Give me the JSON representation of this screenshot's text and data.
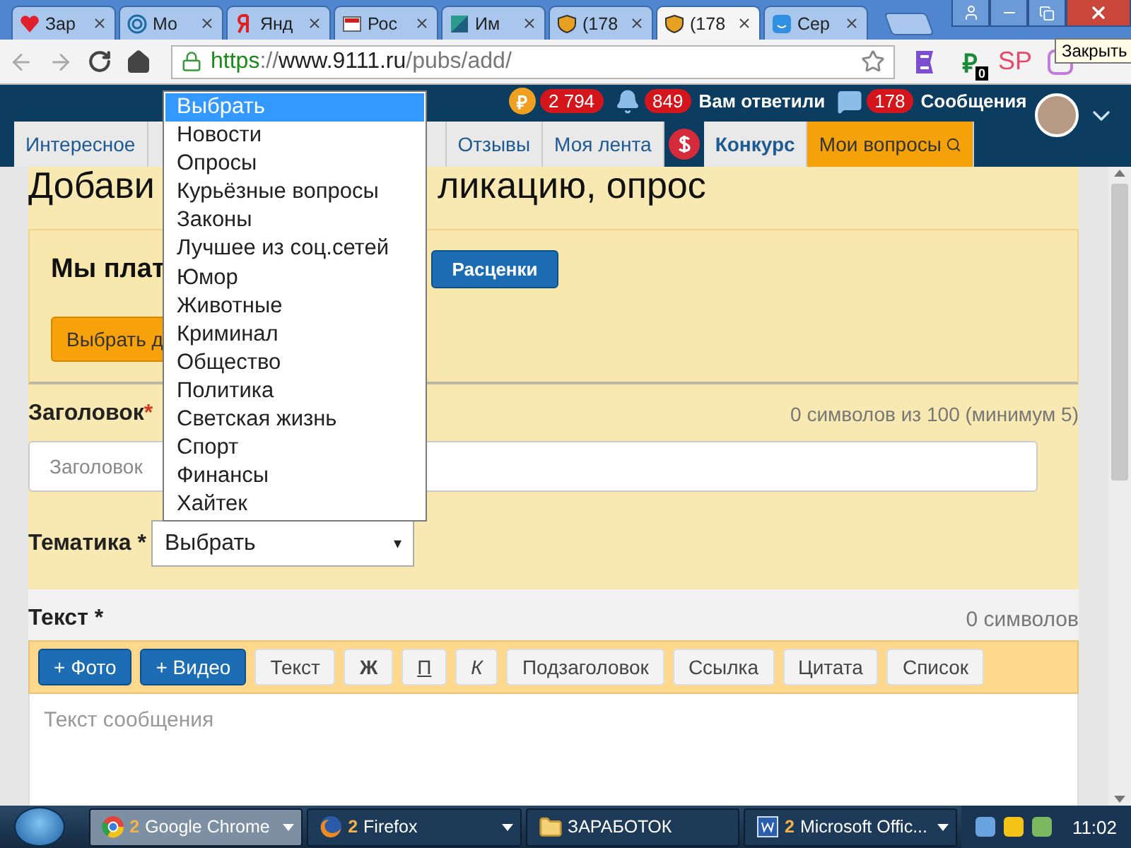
{
  "browser": {
    "tabs": [
      {
        "title": "Зар",
        "kind": "heart",
        "selected": false
      },
      {
        "title": "Мо",
        "kind": "rings",
        "selected": false
      },
      {
        "title": "Янд",
        "kind": "letter",
        "selected": false
      },
      {
        "title": "Рос",
        "kind": "news",
        "selected": false
      },
      {
        "title": "Им",
        "kind": "square",
        "selected": false
      },
      {
        "title": "(178",
        "kind": "shield",
        "selected": false
      },
      {
        "title": "(178",
        "kind": "shield",
        "selected": true
      },
      {
        "title": "Сер",
        "kind": "face",
        "selected": false
      }
    ],
    "url": {
      "scheme": "https",
      "separator": "://",
      "host": "www.9111.ru",
      "path": "/pubs/add/"
    },
    "extensions": [
      {
        "kind": "evernote"
      },
      {
        "kind": "ruble",
        "label": "₽",
        "badge": "0"
      },
      {
        "kind": "text",
        "label": "SP"
      },
      {
        "kind": "purple"
      }
    ],
    "tooltip": "Закрыть"
  },
  "site": {
    "stats": [
      {
        "kind": "coin",
        "symbol": "₽",
        "count": "2 794"
      },
      {
        "kind": "bell",
        "count": "849",
        "label": "Вам ответили"
      },
      {
        "kind": "chat",
        "count": "178",
        "label": "Сообщения"
      }
    ],
    "nav": [
      {
        "kind": "tab",
        "label": "Интересное",
        "selected": false
      },
      {
        "kind": "covered",
        "selected": false
      },
      {
        "kind": "tab",
        "label": "Отзывы",
        "selected": false
      },
      {
        "kind": "tab",
        "label": "Моя лента",
        "selected": false
      },
      {
        "kind": "coin"
      },
      {
        "kind": "bold",
        "label": "Конкурс",
        "selected": false
      },
      {
        "kind": "tab",
        "label": "Мои вопросы",
        "selected": true,
        "search": true
      }
    ]
  },
  "page": {
    "heading_parts": [
      "Добави",
      "ликацию, опрос"
    ],
    "promo": {
      "title": "Мы плат",
      "price_button": "Расценки",
      "action_button": "Выбрать д"
    },
    "title_field": {
      "label": "Заголовок",
      "required": "*",
      "counter": "0 символов из 100 (минимум 5)",
      "placeholder": "Заголовок"
    },
    "topic": {
      "label": "Тематика *",
      "value": "Выбрать",
      "arrow": "▾"
    },
    "text_field": {
      "label": "Текст *",
      "counter": "0 символов",
      "placeholder": "Текст сообщения"
    },
    "editor_buttons": [
      {
        "kind": "primary",
        "label": "+ Фото"
      },
      {
        "kind": "primary",
        "label": "+ Видео"
      },
      {
        "kind": "plain",
        "label": "Текст"
      },
      {
        "kind": "bold",
        "label": "Ж"
      },
      {
        "kind": "underline",
        "label": "П"
      },
      {
        "kind": "italic",
        "label": "К"
      },
      {
        "kind": "plain",
        "label": "Подзаголовок"
      },
      {
        "kind": "plain",
        "label": "Ссылка"
      },
      {
        "kind": "plain",
        "label": "Цитата"
      },
      {
        "kind": "plain",
        "label": "Список"
      }
    ]
  },
  "dropdown": [
    {
      "label": "Выбрать",
      "selected": true
    },
    {
      "label": "Новости",
      "selected": false
    },
    {
      "label": "Опросы",
      "selected": false
    },
    {
      "label": "Курьёзные вопросы",
      "selected": false
    },
    {
      "label": "Законы",
      "selected": false
    },
    {
      "label": "Лучшее из соц.сетей",
      "selected": false
    },
    {
      "label": "Юмор",
      "selected": false
    },
    {
      "label": "Животные",
      "selected": false
    },
    {
      "label": "Криминал",
      "selected": false
    },
    {
      "label": "Общество",
      "selected": false
    },
    {
      "label": "Политика",
      "selected": false
    },
    {
      "label": "Светская жизнь",
      "selected": false
    },
    {
      "label": "Спорт",
      "selected": false
    },
    {
      "label": "Финансы",
      "selected": false
    },
    {
      "label": "Хайтек",
      "selected": false
    }
  ],
  "taskbar": {
    "items": [
      {
        "kind": "chrome",
        "count": "2",
        "label": "Google Chrome",
        "selected": true
      },
      {
        "kind": "firefox",
        "count": "2",
        "label": "Firefox",
        "selected": false
      },
      {
        "kind": "folder",
        "label": "ЗАРАБОТОК",
        "selected": false
      },
      {
        "kind": "word",
        "count": "2",
        "label": "Microsoft Offic...",
        "selected": false
      }
    ],
    "clock": "11:02"
  }
}
